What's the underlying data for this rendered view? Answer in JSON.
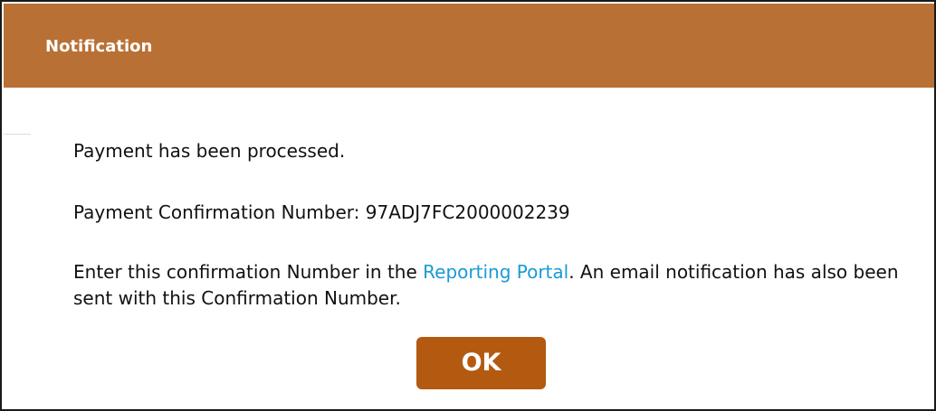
{
  "dialog": {
    "title": "Notification",
    "message_processed": "Payment has been processed.",
    "confirmation_label": "Payment Confirmation Number: 97ADJ7FC2000002239",
    "instructions_before_link": "Enter this confirmation Number in the ",
    "link_text": "Reporting Portal",
    "instructions_after_link": ". An email notification has also been sent with this Confirmation Number.",
    "ok_label": "OK"
  },
  "colors": {
    "header_bg": "#b97034",
    "button_bg": "#b35a10",
    "link": "#1a9ad6"
  }
}
